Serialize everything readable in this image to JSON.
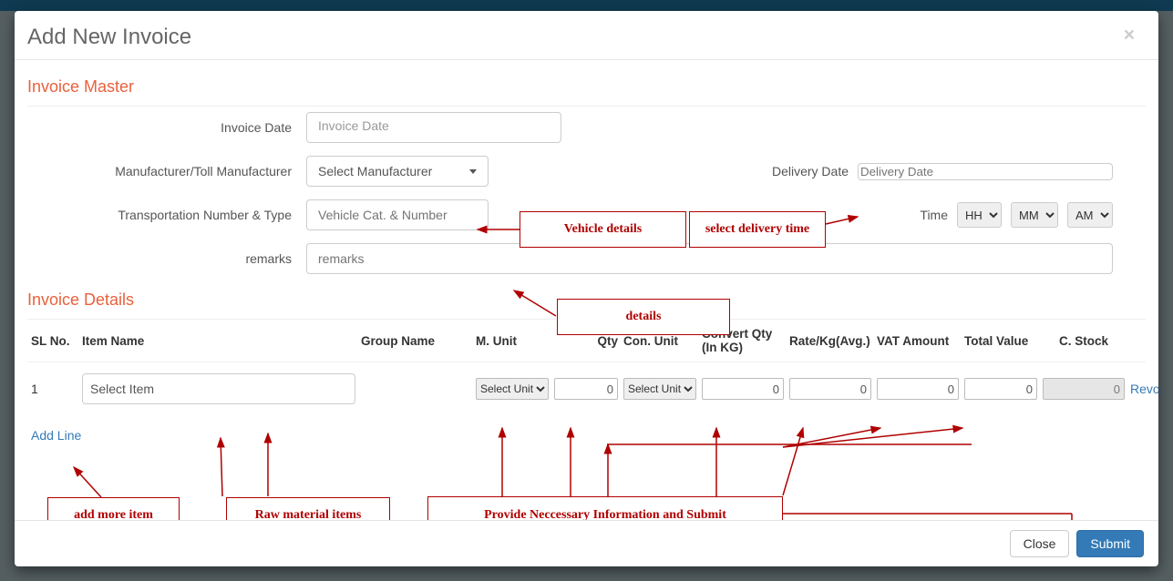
{
  "modal": {
    "title": "Add New Invoice",
    "close_symbol": "×"
  },
  "sections": {
    "master": "Invoice Master",
    "details": "Invoice Details"
  },
  "master": {
    "invoice_date_label": "Invoice Date",
    "invoice_date_placeholder": "Invoice Date",
    "manufacturer_label": "Manufacturer/Toll Manufacturer",
    "manufacturer_select": "Select Manufacturer",
    "delivery_date_label": "Delivery Date",
    "delivery_date_placeholder": "Delivery Date",
    "transport_label": "Transportation Number & Type",
    "transport_placeholder": "Vehicle Cat. & Number",
    "time_label": "Time",
    "time_hh": "HH",
    "time_mm": "MM",
    "time_ampm": "AM",
    "remarks_label": "remarks",
    "remarks_placeholder": "remarks"
  },
  "details": {
    "headers": {
      "sl": "SL No.",
      "item": "Item Name",
      "group": "Group Name",
      "munit": "M. Unit",
      "qty": "Qty",
      "conunit": "Con. Unit",
      "convqty": "Convert Qty (In KG)",
      "rate": "Rate/Kg(Avg.)",
      "vat": "VAT Amount",
      "total": "Total Value",
      "cstock": "C. Stock",
      "remove": ""
    },
    "rows": [
      {
        "sl": "1",
        "item_select": "Select Item",
        "group": "",
        "munit": "Select Unit",
        "qty": "0",
        "conunit": "Select Unit",
        "convqty": "0",
        "rate": "0",
        "vat": "0",
        "total": "0",
        "cstock": "0",
        "remove": "Revome"
      }
    ],
    "add_line": "Add Line"
  },
  "footer": {
    "close": "Close",
    "submit": "Submit"
  },
  "annotations": {
    "vehicle": "Vehicle details",
    "delivery_time": "select delivery time",
    "details": "details",
    "add_more": "add more item",
    "raw_items": "Raw material items",
    "provide": "Provide Neccessary Information and Submit"
  }
}
